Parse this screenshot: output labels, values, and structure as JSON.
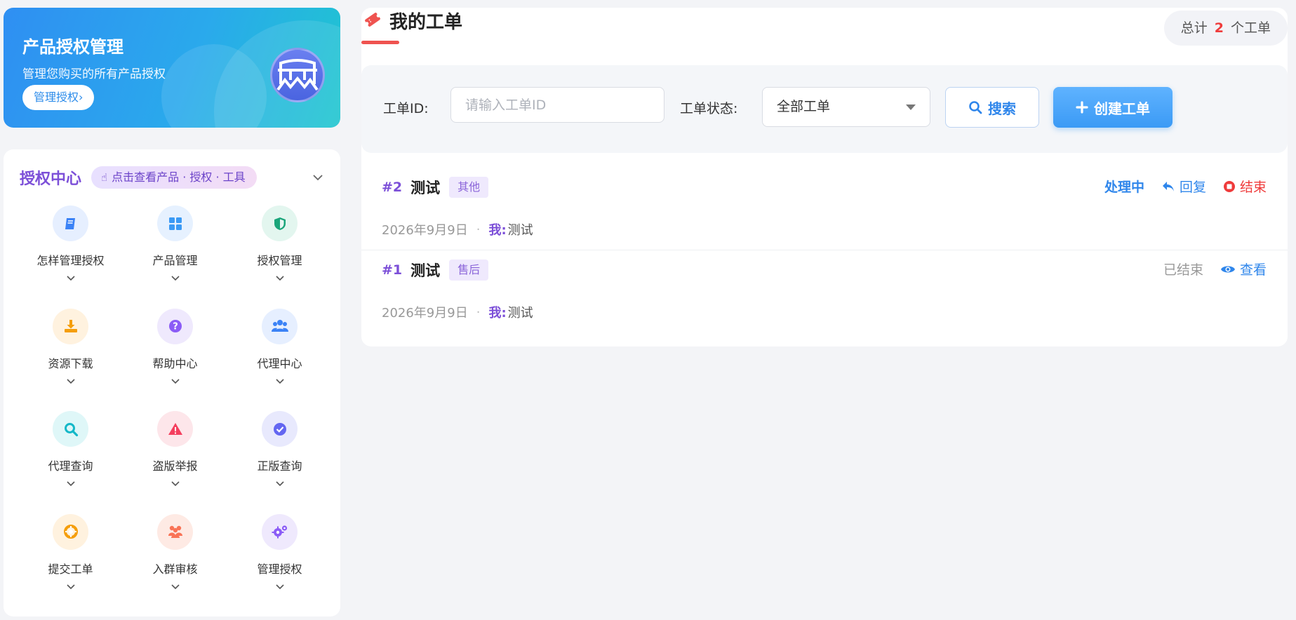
{
  "hero": {
    "title": "产品授权管理",
    "subtitle": "管理您购买的所有产品授权",
    "button_label": "管理授权›"
  },
  "auth_center": {
    "title": "授权中心",
    "chip_label": "点击查看产品 · 授权 · 工具",
    "items": [
      {
        "label": "怎样管理授权",
        "icon": "book-icon",
        "color": "#3b82f6",
        "bg": "#e6efff"
      },
      {
        "label": "产品管理",
        "icon": "grid-icon",
        "color": "#3b9af5",
        "bg": "#e6f1ff"
      },
      {
        "label": "授权管理",
        "icon": "shield-icon",
        "color": "#1aa57a",
        "bg": "#e3f6ef"
      },
      {
        "label": "资源下载",
        "icon": "download-icon",
        "color": "#f59e0b",
        "bg": "#fff2df"
      },
      {
        "label": "帮助中心",
        "icon": "question-icon",
        "color": "#8b5cf6",
        "bg": "#efe9fd"
      },
      {
        "label": "代理中心",
        "icon": "users-icon",
        "color": "#3b82f6",
        "bg": "#e6efff"
      },
      {
        "label": "代理查询",
        "icon": "search-icon",
        "color": "#14b8c8",
        "bg": "#dff7f8"
      },
      {
        "label": "盗版举报",
        "icon": "warning-icon",
        "color": "#f43f5e",
        "bg": "#fde6ea"
      },
      {
        "label": "正版查询",
        "icon": "check-circle-icon",
        "color": "#6366f1",
        "bg": "#e8e9fd"
      },
      {
        "label": "提交工单",
        "icon": "lifebuoy-icon",
        "color": "#f59e0b",
        "bg": "#fff2df"
      },
      {
        "label": "入群审核",
        "icon": "group-icon",
        "color": "#f97356",
        "bg": "#feeae4"
      },
      {
        "label": "管理授权",
        "icon": "gears-icon",
        "color": "#8b5cf6",
        "bg": "#efe9fd"
      }
    ]
  },
  "main": {
    "title": "我的工单",
    "total_prefix": "总计",
    "total_count": "2",
    "total_suffix": "个工单",
    "filter": {
      "id_label": "工单ID:",
      "id_placeholder": "请输入工单ID",
      "status_label": "工单状态:",
      "status_value": "全部工单",
      "search_label": "搜索",
      "create_label": "创建工单"
    },
    "tickets": [
      {
        "id": "#2",
        "name": "测试",
        "category": "其他",
        "date": "2026年9月9日",
        "dot": "·",
        "me_label": "我:",
        "message": "测试",
        "status": "处理中",
        "actions": [
          "回复",
          "结束"
        ]
      },
      {
        "id": "#1",
        "name": "测试",
        "category": "售后",
        "date": "2026年9月9日",
        "dot": "·",
        "me_label": "我:",
        "message": "测试",
        "status": "已结束",
        "actions": [
          "查看"
        ]
      }
    ]
  }
}
